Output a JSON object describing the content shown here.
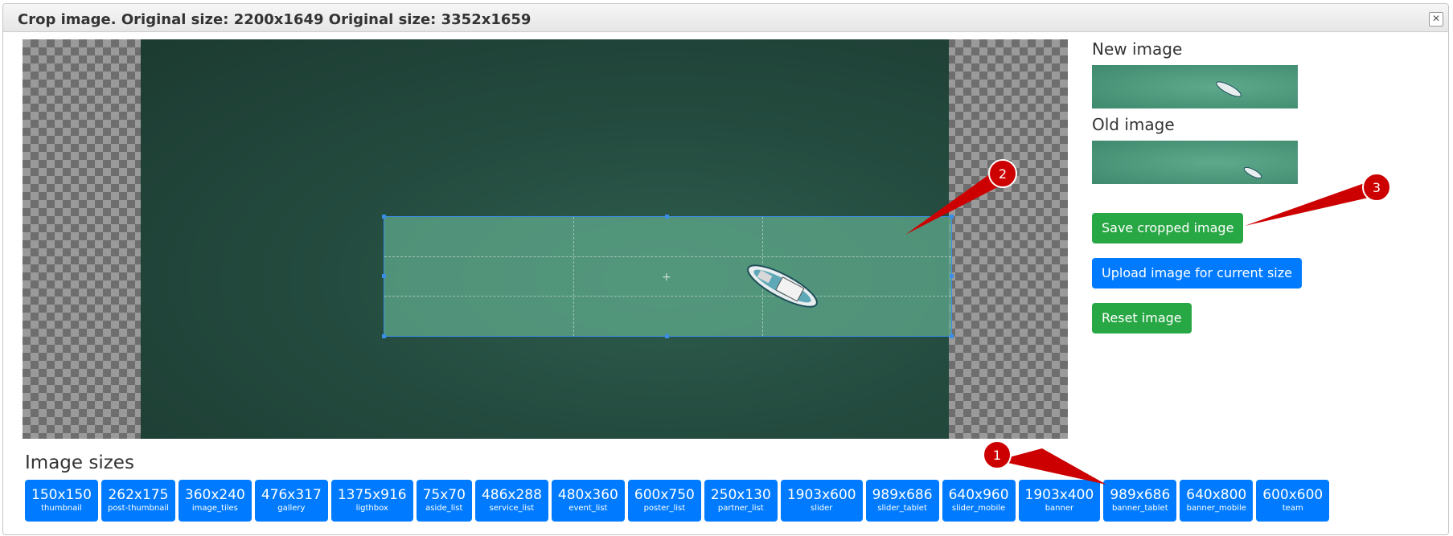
{
  "dialog": {
    "title": "Crop image. Original size: 2200x1649 Original size: 3352x1659",
    "close_symbol": "✕"
  },
  "right_panel": {
    "new_image_label": "New image",
    "old_image_label": "Old image",
    "save_label": "Save cropped image",
    "upload_label": "Upload image for current size",
    "reset_label": "Reset image"
  },
  "sizes": {
    "heading": "Image sizes",
    "items": [
      {
        "dim": "150x150",
        "name": "thumbnail"
      },
      {
        "dim": "262x175",
        "name": "post-thumbnail"
      },
      {
        "dim": "360x240",
        "name": "image_tiles"
      },
      {
        "dim": "476x317",
        "name": "gallery"
      },
      {
        "dim": "1375x916",
        "name": "ligthbox"
      },
      {
        "dim": "75x70",
        "name": "aside_list"
      },
      {
        "dim": "486x288",
        "name": "service_list"
      },
      {
        "dim": "480x360",
        "name": "event_list"
      },
      {
        "dim": "600x750",
        "name": "poster_list"
      },
      {
        "dim": "250x130",
        "name": "partner_list"
      },
      {
        "dim": "1903x600",
        "name": "slider"
      },
      {
        "dim": "989x686",
        "name": "slider_tablet"
      },
      {
        "dim": "640x960",
        "name": "slider_mobile"
      },
      {
        "dim": "1903x400",
        "name": "banner"
      },
      {
        "dim": "989x686",
        "name": "banner_tablet"
      },
      {
        "dim": "640x800",
        "name": "banner_mobile"
      },
      {
        "dim": "600x600",
        "name": "team"
      }
    ]
  },
  "annotations": [
    "1",
    "2",
    "3"
  ],
  "colors": {
    "green": "#28a745",
    "blue": "#007bff",
    "annotation_red": "#cc0000"
  }
}
